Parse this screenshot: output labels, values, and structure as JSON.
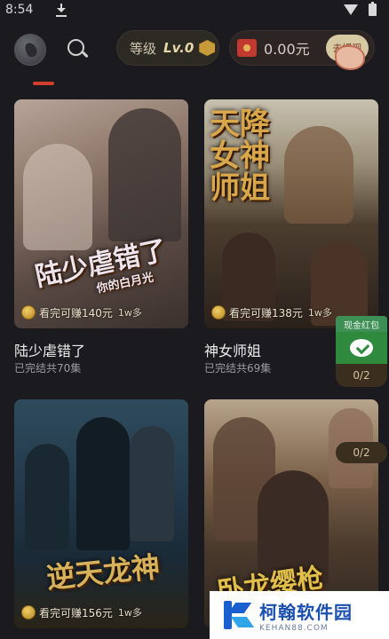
{
  "status_bar": {
    "time": "8:54"
  },
  "header": {
    "level_label": "等级",
    "level_value": "Lv.0",
    "cash_value": "0.00元",
    "withdraw_label": "去提现"
  },
  "cards": [
    {
      "title": "陆少虐错了",
      "meta": "已完结共70集",
      "earn": "看完可赚140元",
      "plays": "1w多",
      "poster_text_1": "陆少虐错了",
      "poster_text_2": "你的白月光"
    },
    {
      "title": "神女师姐",
      "meta": "已完结共69集",
      "earn": "看完可赚138元",
      "plays": "1w多",
      "poster_text_1": "天降女神师姐"
    },
    {
      "title": "",
      "meta": "",
      "earn": "看完可赚156元",
      "plays": "1w多",
      "poster_text_1": "逆天龙神"
    },
    {
      "title": "",
      "meta": "",
      "earn": "",
      "plays": "",
      "poster_text_1": "卧龙缨枪"
    }
  ],
  "red_packet": {
    "label": "现金红包",
    "progress": "0/2",
    "progress_2": "0/2"
  },
  "watermark": {
    "name": "柯翰软件园",
    "url": "KEHAN88.COM"
  },
  "colors": {
    "background": "#1b1b1f",
    "accent": "#d23d2e",
    "gold": "#d8a84a",
    "green": "#2f8a3d"
  }
}
